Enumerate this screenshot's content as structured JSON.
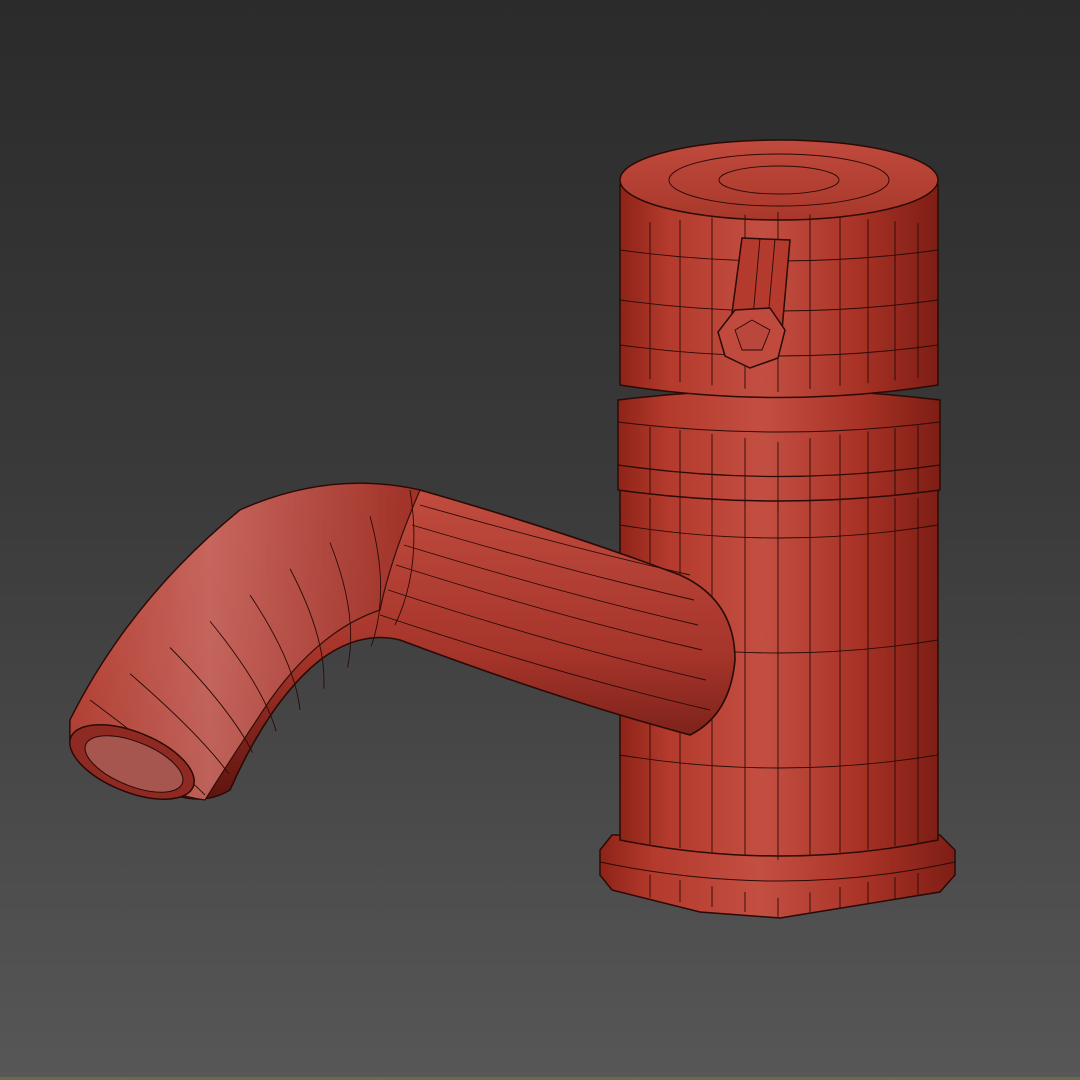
{
  "viewport": {
    "background_top": "#2b2b2b",
    "background_bottom": "#575757",
    "bottom_strip_color": "#6b6a48"
  },
  "model": {
    "base_color": "#b23a2c",
    "light_color": "#c9574a",
    "dark_color": "#6e1a14",
    "wire_color": "#2a0a06",
    "parts": [
      "tap-body",
      "handle-cap",
      "lever-knob",
      "collar-ring",
      "base-flange",
      "spout"
    ]
  }
}
